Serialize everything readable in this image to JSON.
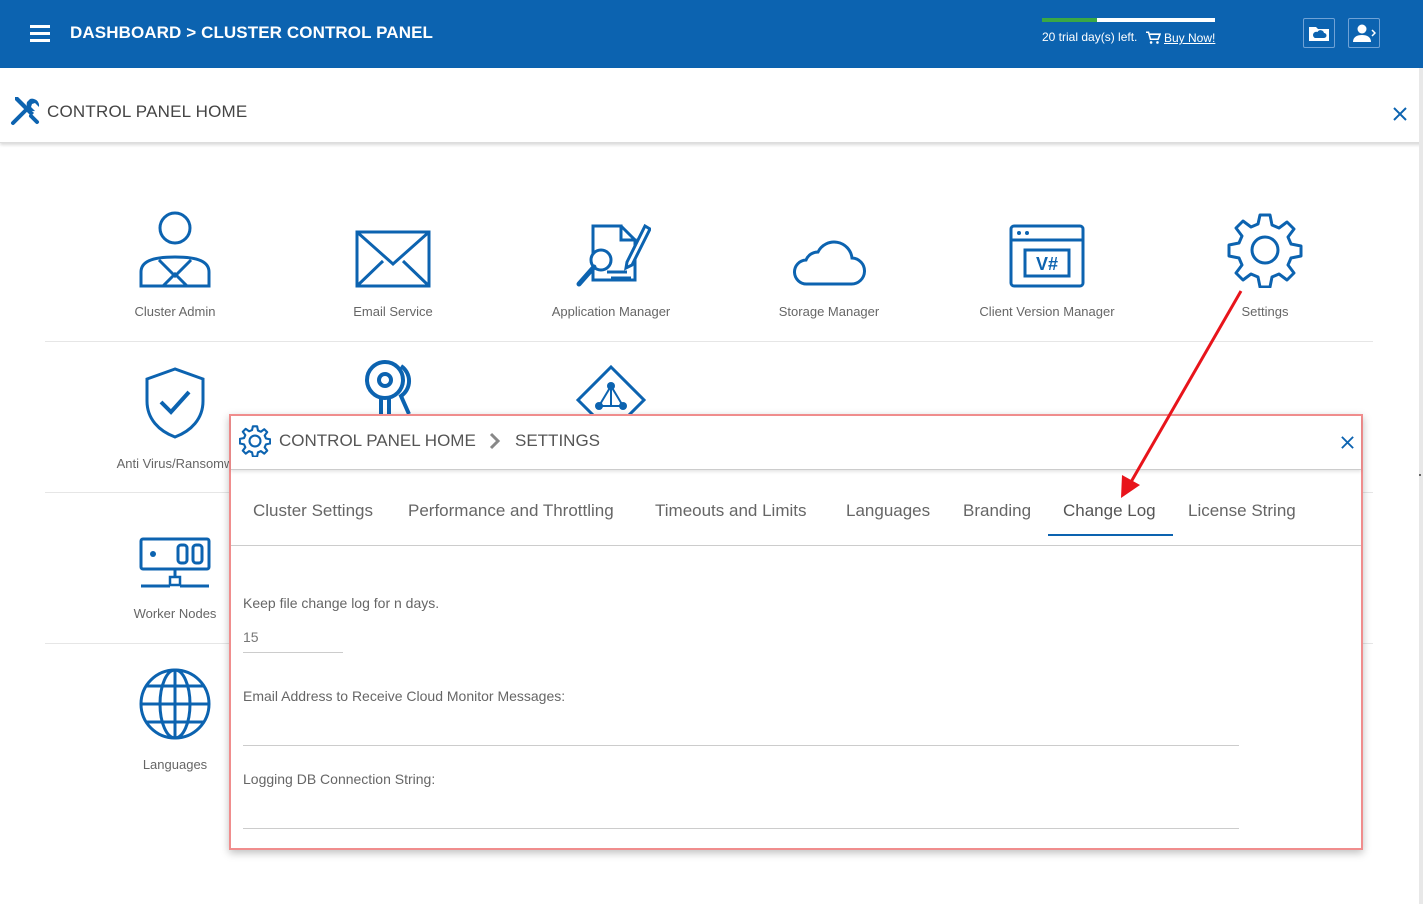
{
  "topbar": {
    "breadcrumb": "DASHBOARD > CLUSTER CONTROL PANEL",
    "trial_text": "20 trial day(s) left.",
    "buy_now": "Buy Now!",
    "trial_progress": 0.32,
    "brand_color": "#0c63b0"
  },
  "control_panel": {
    "title": "CONTROL PANEL HOME"
  },
  "apps": {
    "cluster_admin": "Cluster Admin",
    "email_service": "Email Service",
    "application_manager": "Application Manager",
    "storage_manager": "Storage Manager",
    "client_version_manager": "Client Version Manager",
    "settings": "Settings",
    "anti_virus": "Anti Virus/Ransomw",
    "worker_nodes": "Worker Nodes",
    "languages": "Languages",
    "client_version_icon_text": "V#"
  },
  "modal": {
    "crumb_home": "CONTROL PANEL HOME",
    "crumb_current": "SETTINGS",
    "tabs": [
      "Cluster Settings",
      "Performance and Throttling",
      "Timeouts and Limits",
      "Languages",
      "Branding",
      "Change Log",
      "License String"
    ],
    "active_tab": "Change Log",
    "fields": {
      "keep_log_label": "Keep file change log for n days.",
      "keep_log_value": "15",
      "email_label": "Email Address to Receive Cloud Monitor Messages:",
      "email_value": "",
      "db_label": "Logging DB Connection String:",
      "db_value": ""
    }
  },
  "annotation": {
    "arrow_color": "#e8141b",
    "highlight_border": "#f08d8d"
  }
}
